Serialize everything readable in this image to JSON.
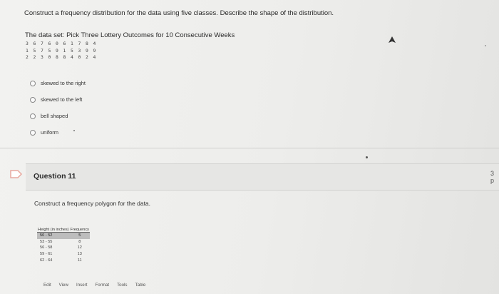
{
  "question10": {
    "prompt": "Construct a frequency distribution for the data using five classes. Describe the shape of the distribution.",
    "dataset_title": "The data set: Pick Three Lottery Outcomes for 10 Consecutive Weeks",
    "data_rows": [
      "3 6 7 6 0 6 1 7 8 4",
      "1 5 7 5 9 1 5 3 9 9",
      "2 2 3 0 8 8 4 0 2 4"
    ],
    "options": [
      "skewed to the right",
      "skewed to the left",
      "bell shaped",
      "uniform"
    ]
  },
  "question11": {
    "title": "Question 11",
    "points": "3 p",
    "prompt": "Construct a frequency polygon for the data.",
    "table": {
      "headers": [
        "Height (in inches)",
        "Frequency"
      ],
      "rows": [
        {
          "height": "50 - 52",
          "frequency": "5"
        },
        {
          "height": "53 - 55",
          "frequency": "8"
        },
        {
          "height": "56 - 58",
          "frequency": "12"
        },
        {
          "height": "59 - 61",
          "frequency": "13"
        },
        {
          "height": "62 - 64",
          "frequency": "11"
        }
      ]
    },
    "editor_menu": [
      "Edit",
      "View",
      "Insert",
      "Format",
      "Tools",
      "Table"
    ]
  },
  "colors": {
    "marker": "#e8a9a0",
    "background": "#efefed"
  }
}
